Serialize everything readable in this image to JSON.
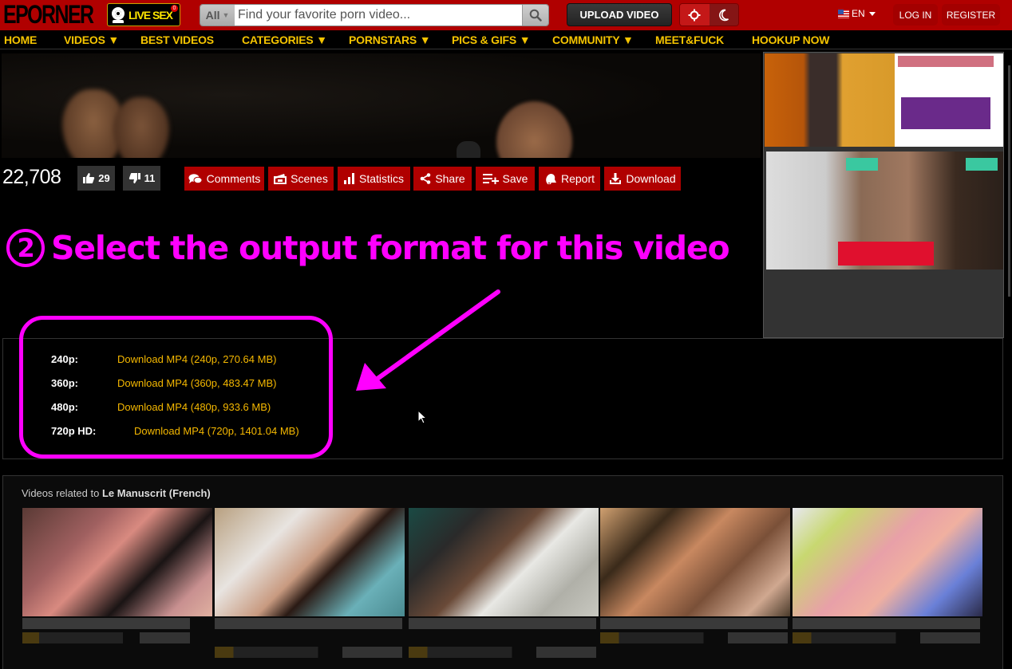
{
  "header": {
    "logo": "EPORNER",
    "live_sex": {
      "label": "LIVE SEX",
      "badge": "0"
    },
    "search": {
      "category": "All",
      "placeholder": "Find your favorite porn video...",
      "value": ""
    },
    "upload_label": "UPLOAD VIDEO",
    "theme": {
      "light_icon": "sun-icon",
      "dark_icon": "moon-icon"
    },
    "language": "EN",
    "login_label": "LOG IN",
    "register_label": "REGISTER"
  },
  "nav": [
    {
      "label": "HOME"
    },
    {
      "label": "VIDEOS ▼"
    },
    {
      "label": "BEST VIDEOS"
    },
    {
      "label": "CATEGORIES ▼"
    },
    {
      "label": "PORNSTARS ▼"
    },
    {
      "label": "PICS & GIFS ▼"
    },
    {
      "label": "COMMUNITY ▼"
    },
    {
      "label": "MEET&FUCK"
    },
    {
      "label": "HOOKUP NOW"
    }
  ],
  "video": {
    "views": "22,708",
    "likes": "29",
    "dislikes": "11",
    "actions": [
      {
        "label": "Comments",
        "icon": "comments-icon"
      },
      {
        "label": "Scenes",
        "icon": "scenes-icon"
      },
      {
        "label": "Statistics",
        "icon": "statistics-icon"
      },
      {
        "label": "Share",
        "icon": "share-icon"
      },
      {
        "label": "Save",
        "icon": "playlist-add-icon"
      },
      {
        "label": "Report",
        "icon": "report-icon"
      },
      {
        "label": "Download",
        "icon": "download-icon"
      }
    ]
  },
  "annotation": {
    "step_number": "2",
    "text": "Select the output format for this video",
    "color": "#ff00ff"
  },
  "downloads": [
    {
      "quality": "240p:",
      "link": "Download MP4 (240p, 270.64 MB)"
    },
    {
      "quality": "360p:",
      "link": "Download MP4 (360p, 483.47 MB)"
    },
    {
      "quality": "480p:",
      "link": "Download MP4 (480p, 933.6 MB)"
    },
    {
      "quality": "720p HD:",
      "link": "Download MP4 (720p, 1401.04 MB)"
    }
  ],
  "related": {
    "prefix": "Videos related to ",
    "title": "Le Manuscrit (French)",
    "count": 5
  },
  "colors": {
    "brand_red": "#b00000",
    "nav_yellow": "#f5c400",
    "link_gold": "#f5b800",
    "highlight": "#ff00ff"
  }
}
